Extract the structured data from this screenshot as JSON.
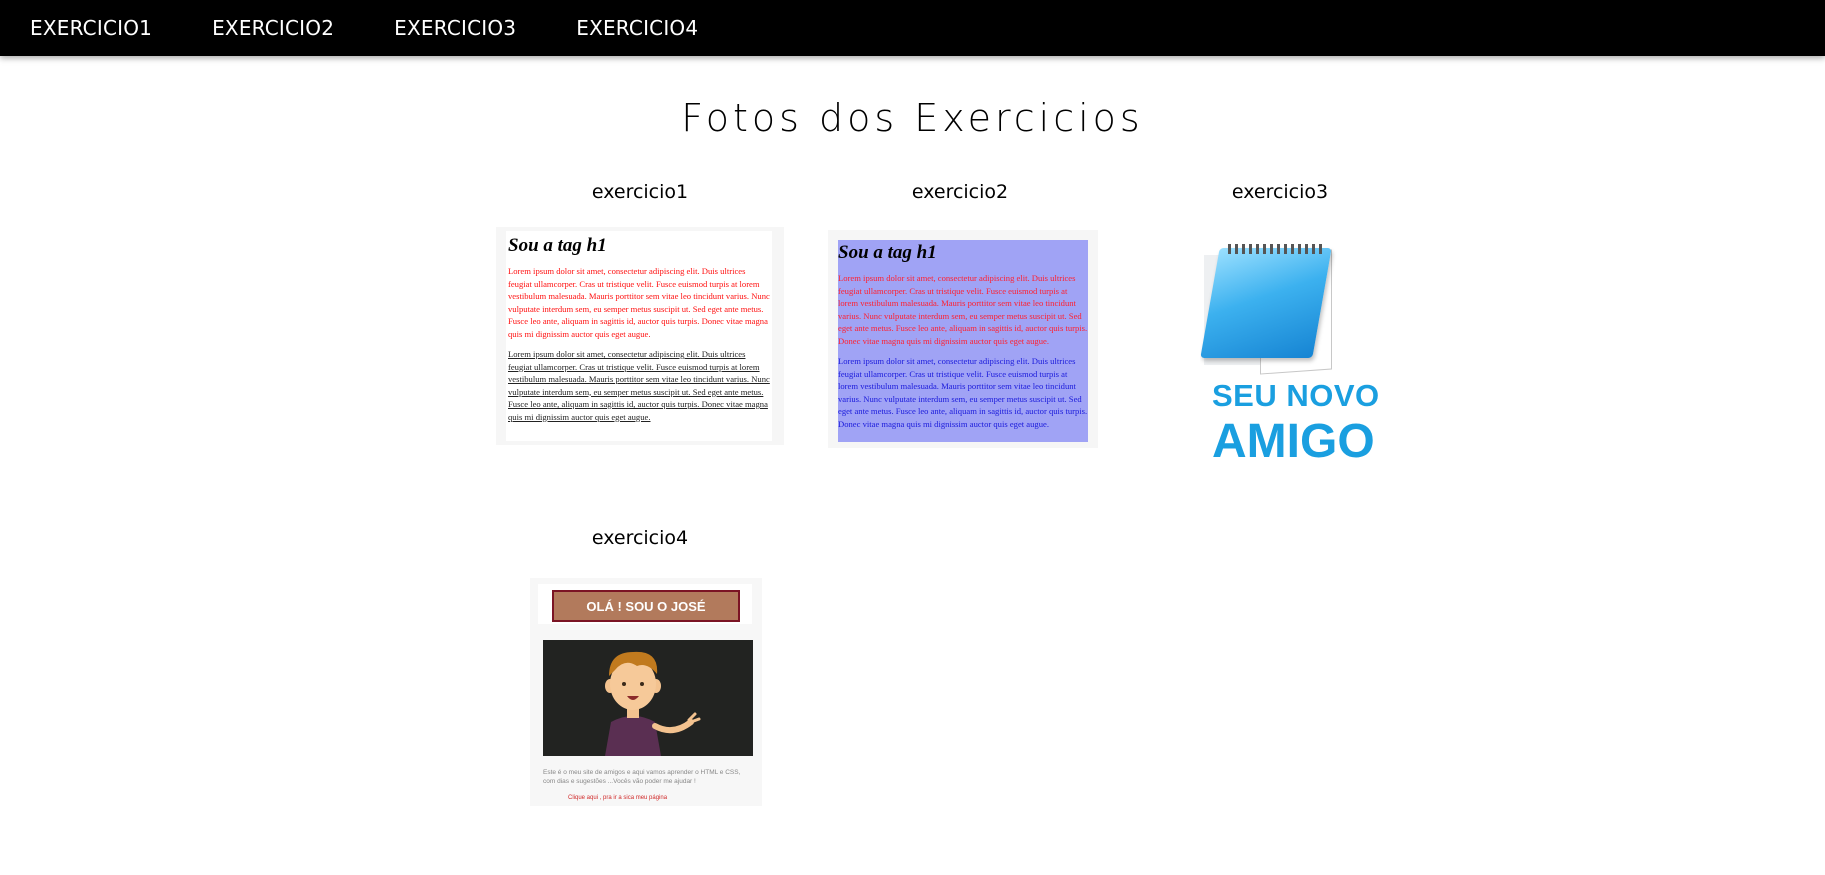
{
  "nav": {
    "items": [
      {
        "label": "EXERCICIO1"
      },
      {
        "label": "EXERCICIO2"
      },
      {
        "label": "EXERCICIO3"
      },
      {
        "label": "EXERCICIO4"
      }
    ]
  },
  "main": {
    "title": "Fotos dos Exercicios",
    "cards": [
      {
        "title": "exercicio1"
      },
      {
        "title": "exercicio2"
      },
      {
        "title": "exercicio3"
      },
      {
        "title": "exercicio4"
      }
    ]
  },
  "thumbs": {
    "ex1": {
      "heading": "Sou a tag h1",
      "para1": "Lorem ipsum dolor sit amet, consectetur adipiscing elit. Duis ultrices feugiat ullamcorper. Cras ut tristique velit. Fusce euismod turpis at lorem vestibulum malesuada. Mauris porttitor sem vitae leo tincidunt varius. Nunc vulputate interdum sem, eu semper metus suscipit ut. Sed eget ante metus. Fusce leo ante, aliquam in sagittis id, auctor quis turpis. Donec vitae magna quis mi dignissim auctor quis eget augue.",
      "para2": "Lorem ipsum dolor sit amet, consectetur adipiscing elit. Duis ultrices feugiat ullamcorper. Cras ut tristique velit. Fusce euismod turpis at lorem vestibulum malesuada. Mauris porttitor sem vitae leo tincidunt varius. Nunc vulputate interdum sem, eu semper metus suscipit ut. Sed eget ante metus. Fusce leo ante, aliquam in sagittis id, auctor quis turpis. Donec vitae magna quis mi dignissim auctor quis eget augue."
    },
    "ex2": {
      "heading": "Sou a tag h1",
      "para1": "Lorem ipsum dolor sit amet, consectetur adipiscing elit. Duis ultrices feugiat ullamcorper. Cras ut tristique velit. Fusce euismod turpis at lorem vestibulum malesuada. Mauris porttitor sem vitae leo tincidunt varius. Nunc vulputate interdum sem, eu semper metus suscipit ut. Sed eget ante metus. Fusce leo ante, aliquam in sagittis id, auctor quis turpis. Donec vitae magna quis mi dignissim auctor quis eget augue.",
      "para2": "Lorem ipsum dolor sit amet, consectetur adipiscing elit. Duis ultrices feugiat ullamcorper. Cras ut tristique velit. Fusce euismod turpis at lorem vestibulum malesuada. Mauris porttitor sem vitae leo tincidunt varius. Nunc vulputate interdum sem, eu semper metus suscipit ut. Sed eget ante metus. Fusce leo ante, aliquam in sagittis id, auctor quis turpis. Donec vitae magna quis mi dignissim auctor quis eget augue."
    },
    "ex3": {
      "line1": "SEU NOVO",
      "line2": "AMIGO"
    },
    "ex4": {
      "button_label": "OLÁ !  SOU O JOSÉ",
      "para": "Este é o meu site de amigos e aqui vamos aprender o HTML e CSS, com dias e sugestões ...Vocês vão poder me ajudar !",
      "link": "Clique aqui , pra ir a sica meu página"
    }
  },
  "colors": {
    "navbar_bg": "#000000",
    "nav_text": "#ffffff",
    "ex2_bg": "#a0a3f5",
    "ex3_blue": "#1a9fe0",
    "ex4_button": "#b27a5c",
    "ex4_button_border": "#7b1424"
  }
}
